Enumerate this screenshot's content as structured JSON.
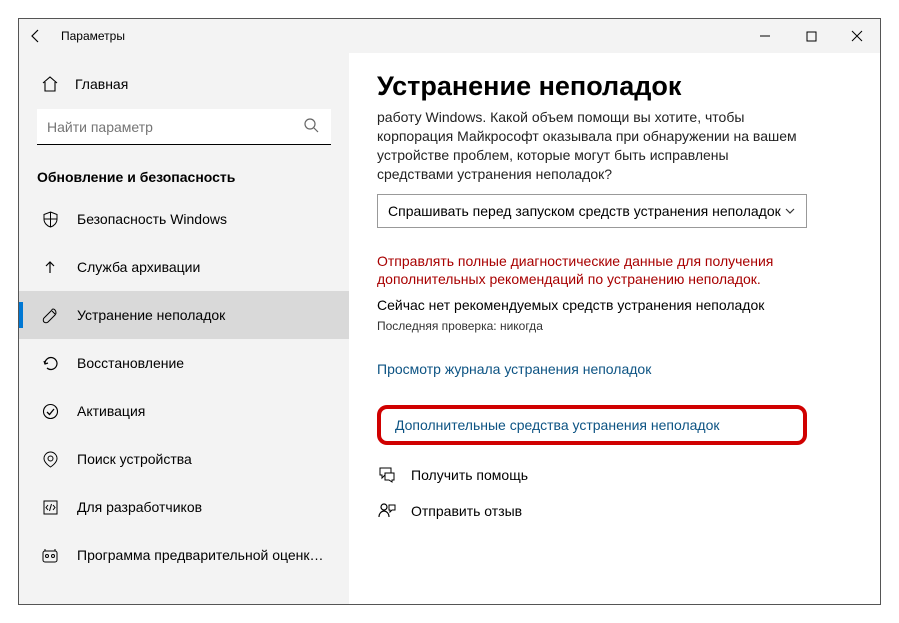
{
  "titlebar": {
    "title": "Параметры"
  },
  "sidebar": {
    "home": "Главная",
    "search_placeholder": "Найти параметр",
    "section": "Обновление и безопасность",
    "items": [
      {
        "label": "Безопасность Windows",
        "icon": "shield"
      },
      {
        "label": "Служба архивации",
        "icon": "archive"
      },
      {
        "label": "Устранение неполадок",
        "icon": "troubleshoot",
        "active": true
      },
      {
        "label": "Восстановление",
        "icon": "recovery"
      },
      {
        "label": "Активация",
        "icon": "activation"
      },
      {
        "label": "Поиск устройства",
        "icon": "find-device"
      },
      {
        "label": "Для разработчиков",
        "icon": "developer"
      },
      {
        "label": "Программа предварительной оценки Windows",
        "icon": "insider"
      }
    ]
  },
  "main": {
    "title": "Устранение неполадок",
    "intro": "работу Windows. Какой объем помощи вы хотите, чтобы корпорация Майкрософт оказывала при обнаружении на вашем устройстве проблем, которые могут быть исправлены средствами устранения неполадок?",
    "dropdown": "Спрашивать перед запуском средств устранения неполадок",
    "warning": "Отправлять полные диагностические данные для получения дополнительных рекомендаций по устранению неполадок.",
    "status": "Сейчас нет рекомендуемых средств устранения неполадок",
    "last_check": "Последняя проверка: никогда",
    "history_link": "Просмотр журнала устранения неполадок",
    "additional_link": "Дополнительные средства устранения неполадок",
    "get_help": "Получить помощь",
    "feedback": "Отправить отзыв"
  }
}
